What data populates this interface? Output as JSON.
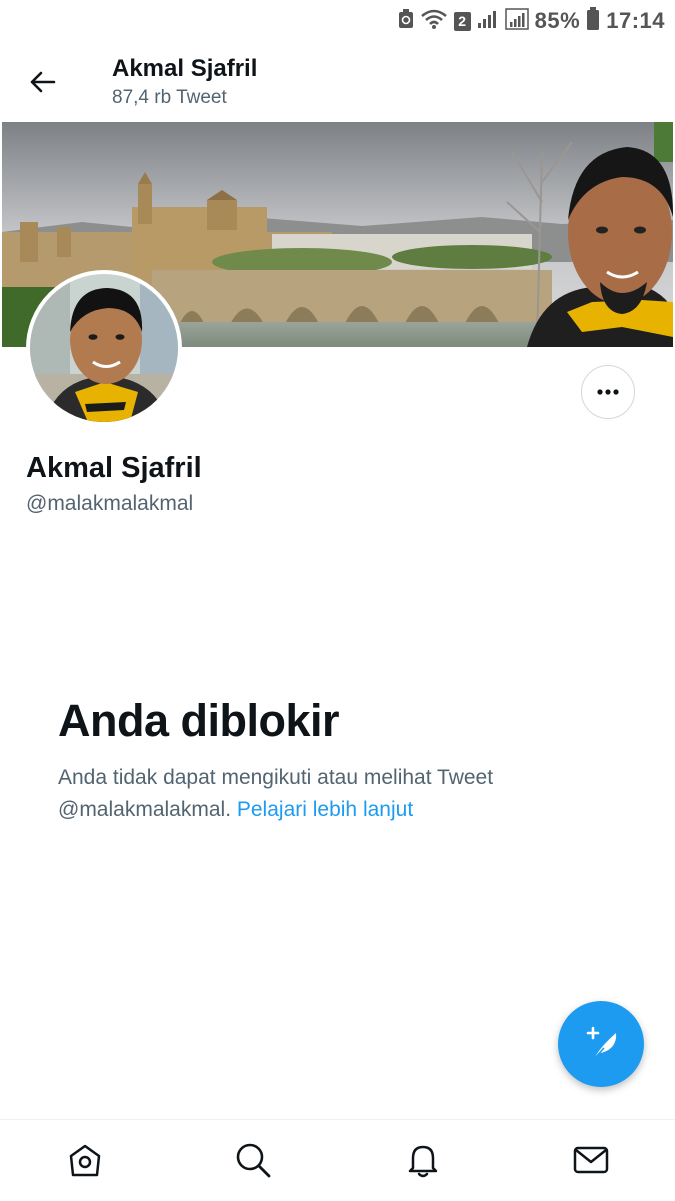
{
  "status_bar": {
    "sim_badge": "2",
    "battery_percent": "85%",
    "time": "17:14"
  },
  "header": {
    "title": "Akmal Sjafril",
    "subtitle": "87,4 rb Tweet"
  },
  "profile": {
    "name": "Akmal Sjafril",
    "handle": "@malakmalakmal"
  },
  "blocked": {
    "title": "Anda diblokir",
    "description_line1": "Anda tidak dapat mengikuti atau melihat Tweet",
    "description_handle": "@malakmalakmal.",
    "learn_more": "Pelajari lebih lanjut"
  },
  "icons": {
    "back": "arrow-left-icon",
    "more": "more-horizontal-icon",
    "compose": "compose-tweet-icon",
    "nav": [
      "home-icon",
      "search-icon",
      "notifications-icon",
      "messages-icon"
    ]
  },
  "colors": {
    "accent": "#1d9bf0",
    "text_primary": "#0f1419",
    "text_secondary": "#536471"
  }
}
